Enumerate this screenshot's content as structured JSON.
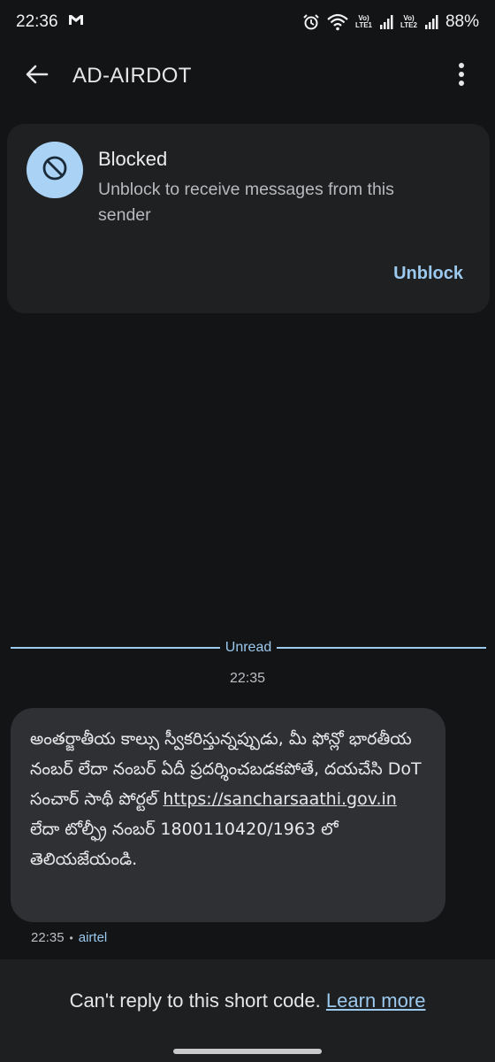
{
  "status_bar": {
    "time": "22:36",
    "carrier_icon": "gmail-icon",
    "sim1_label_top": "Vo)",
    "sim1_label_bottom": "LTE1",
    "sim2_label_top": "Vo)",
    "sim2_label_bottom": "LTE2",
    "battery_percent": "88%"
  },
  "app_bar": {
    "back_icon": "arrow-back-icon",
    "title": "AD-AIRDOT",
    "more_icon": "more-vert-icon"
  },
  "blocked_card": {
    "icon": "block-icon",
    "title": "Blocked",
    "subtitle": "Unblock to receive messages from this sender",
    "action_label": "Unblock"
  },
  "conversation": {
    "unread_label": "Unread",
    "timestamp": "22:35",
    "message": {
      "text_before_link": "అంతర్జాతీయ కాల్సు స్వీకరిస్తున్నప్పుడు, మీ ఫోన్లో భారతీయ నంబర్ లేదా నంబర్ ఏదీ ప్రదర్శించబడకపోతే, దయచేసి DoT సంచార్ సాథీ పోర్టల్ ",
      "link": "https://sancharsaathi.gov.in",
      "text_after_link": " లేదా టోల్ఫ్రీ నంబర్ 1800110420/1963 లో తెలియజేయండి.",
      "time": "22:35",
      "sim": "airtel"
    }
  },
  "bottom_bar": {
    "notice": "Can't reply to this short code.",
    "learn_more": "Learn more"
  },
  "colors": {
    "background": "#131416",
    "card": "#1f2022",
    "bubble": "#2f3033",
    "accent": "#9cc9ee",
    "blocked_icon_bg": "#a9d2f5"
  }
}
